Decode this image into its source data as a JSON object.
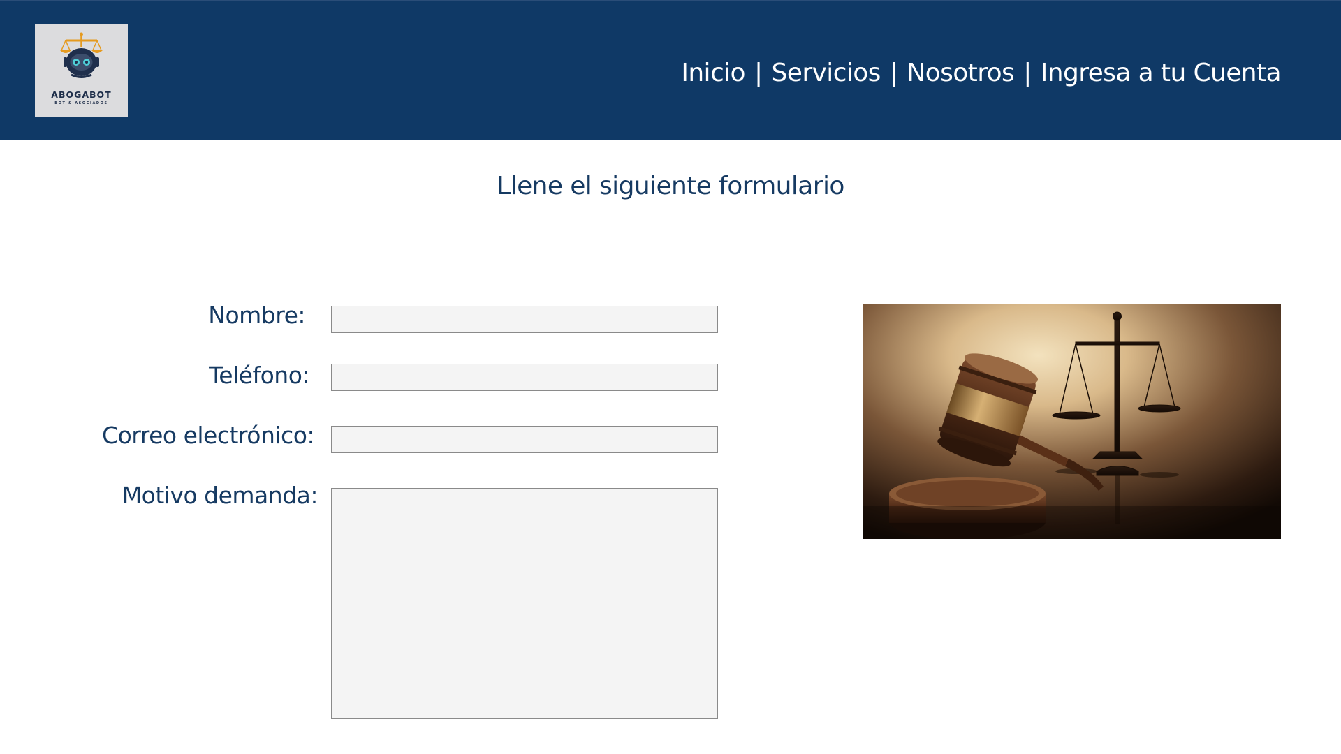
{
  "header": {
    "background_color": "#0f3966",
    "logo": {
      "brand": "ABOGABOT",
      "subtitle": "BOT & ASOCIADOS"
    },
    "nav": {
      "items": [
        {
          "label": "Inicio"
        },
        {
          "label": "Servicios"
        },
        {
          "label": "Nosotros"
        },
        {
          "label": "Ingresa a tu Cuenta"
        }
      ],
      "separator": "|"
    }
  },
  "main": {
    "title": "Llene el siguiente formulario",
    "title_color": "#163a62",
    "form": {
      "fields": [
        {
          "label": "Nombre:",
          "value": "",
          "type": "text"
        },
        {
          "label": "Teléfono:",
          "value": "",
          "type": "tel"
        },
        {
          "label": "Correo electrónico:",
          "value": "",
          "type": "email"
        },
        {
          "label": "Motivo demanda:",
          "value": "",
          "type": "textarea"
        }
      ]
    },
    "image": {
      "icon": "gavel-and-scales-photo"
    }
  }
}
